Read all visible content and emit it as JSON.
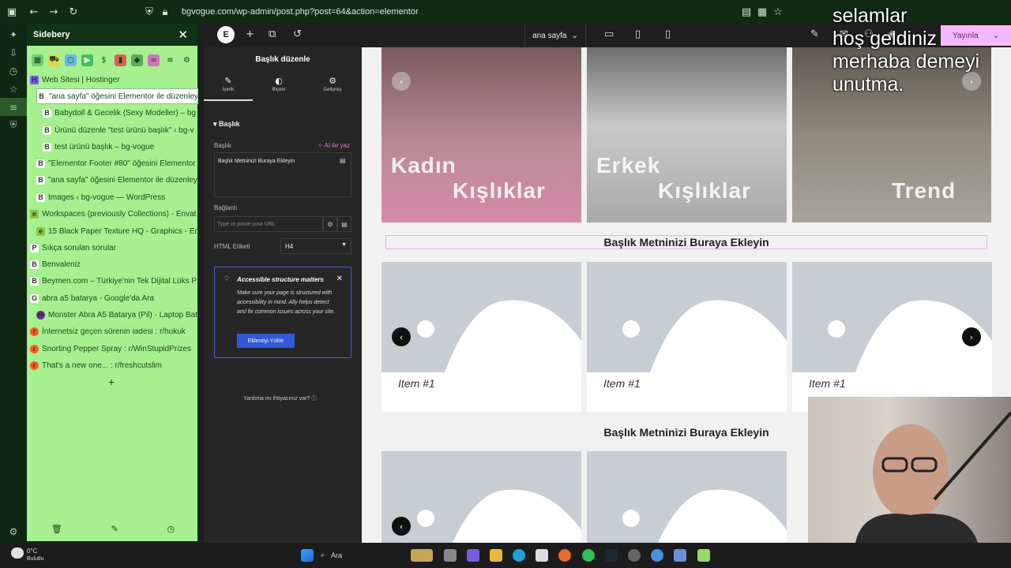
{
  "browser": {
    "url": "bgvogue.com/wp-admin/post.php?post=64&action=elementor"
  },
  "sidebery": {
    "title": "Sidebery",
    "tabs": [
      {
        "label": "Web Sitesi | Hostinger",
        "icon": "H"
      },
      {
        "label": "\"ana sayfa\" öğesini Elementor ile düzenley",
        "icon": "B"
      },
      {
        "label": "Babydoll & Gecelik (Sexy Modeller) – bg",
        "icon": "B"
      },
      {
        "label": "Ürünü düzenle \"test ürünü başlık\" ‹ bg-v",
        "icon": "B"
      },
      {
        "label": "test ürünü başlık – bg-vogue",
        "icon": "B"
      },
      {
        "label": "\"Elementor Footer #80\" öğesini Elementor",
        "icon": "B"
      },
      {
        "label": "\"ana sayfa\" öğesini Elementor ile düzenley",
        "icon": "B"
      },
      {
        "label": "Images ‹ bg-vogue — WordPress",
        "icon": "B"
      },
      {
        "label": "Workspaces (previously Collections) - Envat",
        "icon": "e"
      },
      {
        "label": "15 Black Paper Texture HQ - Graphics - En",
        "icon": "e"
      },
      {
        "label": "Sıkça sorulan sorular",
        "icon": "P"
      },
      {
        "label": "Benvaleniz",
        "icon": "B"
      },
      {
        "label": "Beymen.com – Türkiye'nin Tek Dijital Lüks P",
        "icon": "B"
      },
      {
        "label": "abra a5 batarya - Google'da Ara",
        "icon": "G"
      },
      {
        "label": "Monster Abra A5 Batarya (Pil) - Laptop Bat",
        "icon": "M"
      },
      {
        "label": "İnternetsiz geçen sürenin iadesi : r/hukuk",
        "icon": "r"
      },
      {
        "label": "Snorting Pepper Spray : r/WinStupidPrizes",
        "icon": "r"
      },
      {
        "label": "That's a new one... : r/freshcutslim",
        "icon": "r"
      }
    ]
  },
  "weather": {
    "temp": "0°C",
    "desc": "Bulutlu"
  },
  "elementor": {
    "page_select": "ana sayfa",
    "publish_label": "Yayınla",
    "panel": {
      "title": "Başlık düzenle",
      "tabs": [
        "İçerik",
        "Biçem",
        "Gelişmiş"
      ],
      "section": "Başlık",
      "title_label": "Başlık",
      "ai_label": "AI ile yaz",
      "title_value": "Başlık Metninizi Buraya Ekleyin",
      "link_label": "Bağlantı",
      "link_placeholder": "Type or paste your URL",
      "html_tag_label": "HTML Etiketi",
      "html_tag_value": "H4",
      "notice_title": "Accessible structure matters",
      "notice_body": "Make sure your page is structured with accessibility in mind. Ally helps detect and fix common issues across your site.",
      "notice_button": "Eklentiyi Yükle",
      "help_text": "Yardıma mı ihtiyacınız var?"
    }
  },
  "canvas": {
    "hero": [
      {
        "line1": "Kadın",
        "line2": "Kışlıklar",
        "color": "#c98a9a"
      },
      {
        "line1": "Erkek",
        "line2": "Kışlıklar",
        "color": "#b7b7b7"
      },
      {
        "line1": "",
        "line2": "Trend",
        "color": "#8b8b80"
      }
    ],
    "heading1": "Başlık Metninizi Buraya Ekleyin",
    "heading2": "Başlık Metninizi Buraya Ekleyin",
    "items": [
      "Item #1",
      "Item #1",
      "Item #1"
    ]
  },
  "overlay_text": [
    "selamlar",
    "hoş geldiniz",
    "merhaba demeyi",
    "unutma."
  ],
  "taskbar": {
    "search": "Ara"
  }
}
